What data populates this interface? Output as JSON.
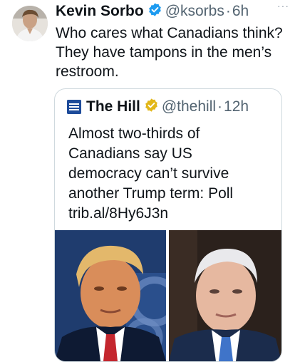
{
  "tweet": {
    "author_name": "Kevin Sorbo",
    "handle": "@ksorbs",
    "separator": "·",
    "time": "6h",
    "more": "···",
    "text": "Who cares what Canadians think? They have tampons in the men’s restroom.",
    "verified_color": "#1d9bf0"
  },
  "quoted_tweet": {
    "author_name": "The Hill",
    "handle": "@thehill",
    "separator": "·",
    "time": "12h",
    "text_lines": [
      "Almost two-thirds of",
      "Canadians say US",
      "democracy can’t survive",
      "another Trump term: Poll",
      "trib.al/8Hy6J3n"
    ],
    "verified_color": "#e2b719",
    "logo_lettering": "THE HILL"
  }
}
